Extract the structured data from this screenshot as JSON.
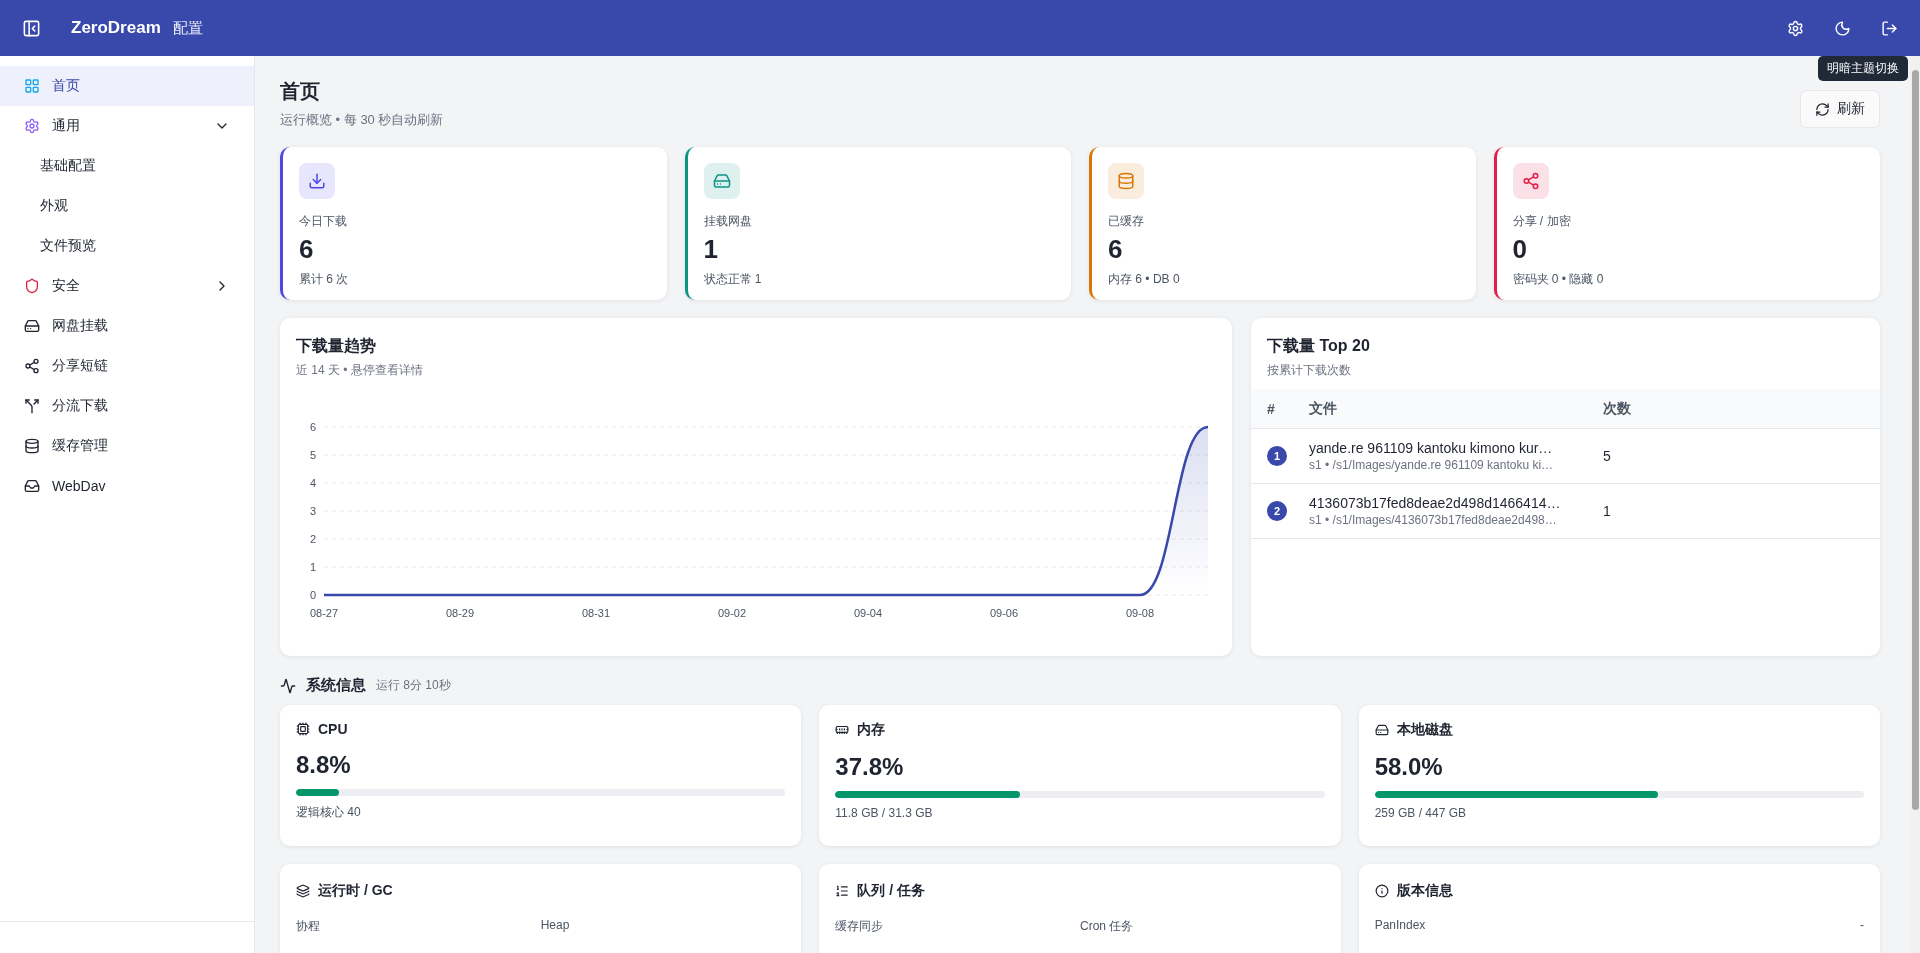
{
  "header": {
    "title": "ZeroDream",
    "subtitle": "配置"
  },
  "tooltip": "明暗主题切换",
  "sidebar": {
    "items": [
      {
        "label": "首页",
        "selected": true
      },
      {
        "label": "通用",
        "selected": false,
        "expanded": true,
        "children": [
          {
            "label": "基础配置",
            "selected": false
          },
          {
            "label": "外观",
            "selected": false
          },
          {
            "label": "文件预览",
            "selected": false
          }
        ]
      },
      {
        "label": "安全",
        "selected": false,
        "expanded": false
      },
      {
        "label": "网盘挂载",
        "selected": false
      },
      {
        "label": "分享短链",
        "selected": false
      },
      {
        "label": "分流下载",
        "selected": false
      },
      {
        "label": "缓存管理",
        "selected": false
      },
      {
        "label": "WebDav",
        "selected": false
      }
    ]
  },
  "page": {
    "title": "首页",
    "subtitle": "运行概览 • 每 30 秒自动刷新",
    "refresh_button": "刷新"
  },
  "stats": [
    {
      "label": "今日下载",
      "value": "6",
      "detail": "累计 6 次",
      "color": "#4f46e5"
    },
    {
      "label": "挂载网盘",
      "value": "1",
      "detail": "状态正常 1",
      "color": "#0d9488"
    },
    {
      "label": "已缓存",
      "value": "6",
      "detail": "内存 6 • DB 0",
      "color": "#d97706"
    },
    {
      "label": "分享 / 加密",
      "value": "0",
      "detail": "密码夹 0 • 隐藏 0",
      "color": "#e11d48"
    }
  ],
  "trend": {
    "title": "下载量趋势",
    "subtitle": "近 14 天 • 悬停查看详情",
    "chart_data": {
      "type": "area",
      "categories": [
        "08-27",
        null,
        "08-29",
        null,
        "08-31",
        null,
        "09-02",
        null,
        "09-04",
        null,
        "09-06",
        null,
        "09-08",
        null
      ],
      "series": [
        {
          "color": "#3949ab",
          "values": [
            0,
            0,
            0,
            0,
            0,
            0,
            0,
            0,
            0,
            0,
            0,
            0,
            0,
            6
          ]
        }
      ],
      "ylim": [
        0,
        6
      ],
      "yticks": [
        0,
        1,
        2,
        3,
        4,
        5,
        6
      ],
      "grid": true
    }
  },
  "top20": {
    "title": "下载量 Top 20",
    "subtitle": "按累计下载次数",
    "columns": [
      "#",
      "文件",
      "次数"
    ],
    "rows": [
      {
        "rank": "1",
        "name": "yande.re 961109 kantoku kimono kur…",
        "path": "s1 • /s1/Images/yande.re 961109 kantoku ki…",
        "count": "5"
      },
      {
        "rank": "2",
        "name": "4136073b17fed8deae2d498d1466414…",
        "path": "s1 • /s1/Images/4136073b17fed8deae2d498…",
        "count": "1"
      }
    ]
  },
  "system": {
    "title": "系统信息",
    "uptime": "运行 8分 10秒",
    "resources": [
      {
        "name": "CPU",
        "value": "8.8%",
        "level": 0.088,
        "detail": "逻辑核心 40"
      },
      {
        "name": "内存",
        "value": "37.8%",
        "level": 0.378,
        "detail": "11.8 GB / 31.3 GB"
      },
      {
        "name": "本地磁盘",
        "value": "58.0%",
        "level": 0.58,
        "detail": "259 GB / 447 GB"
      }
    ],
    "panels": [
      {
        "title": "运行时 / GC",
        "fields": [
          {
            "label": "协程"
          },
          {
            "label": "Heap"
          }
        ]
      },
      {
        "title": "队列 / 任务",
        "fields": [
          {
            "label": "缓存同步"
          },
          {
            "label": "Cron 任务"
          }
        ]
      },
      {
        "title": "版本信息",
        "fields": [
          {
            "label": "PanIndex",
            "value": "-"
          }
        ]
      }
    ]
  }
}
